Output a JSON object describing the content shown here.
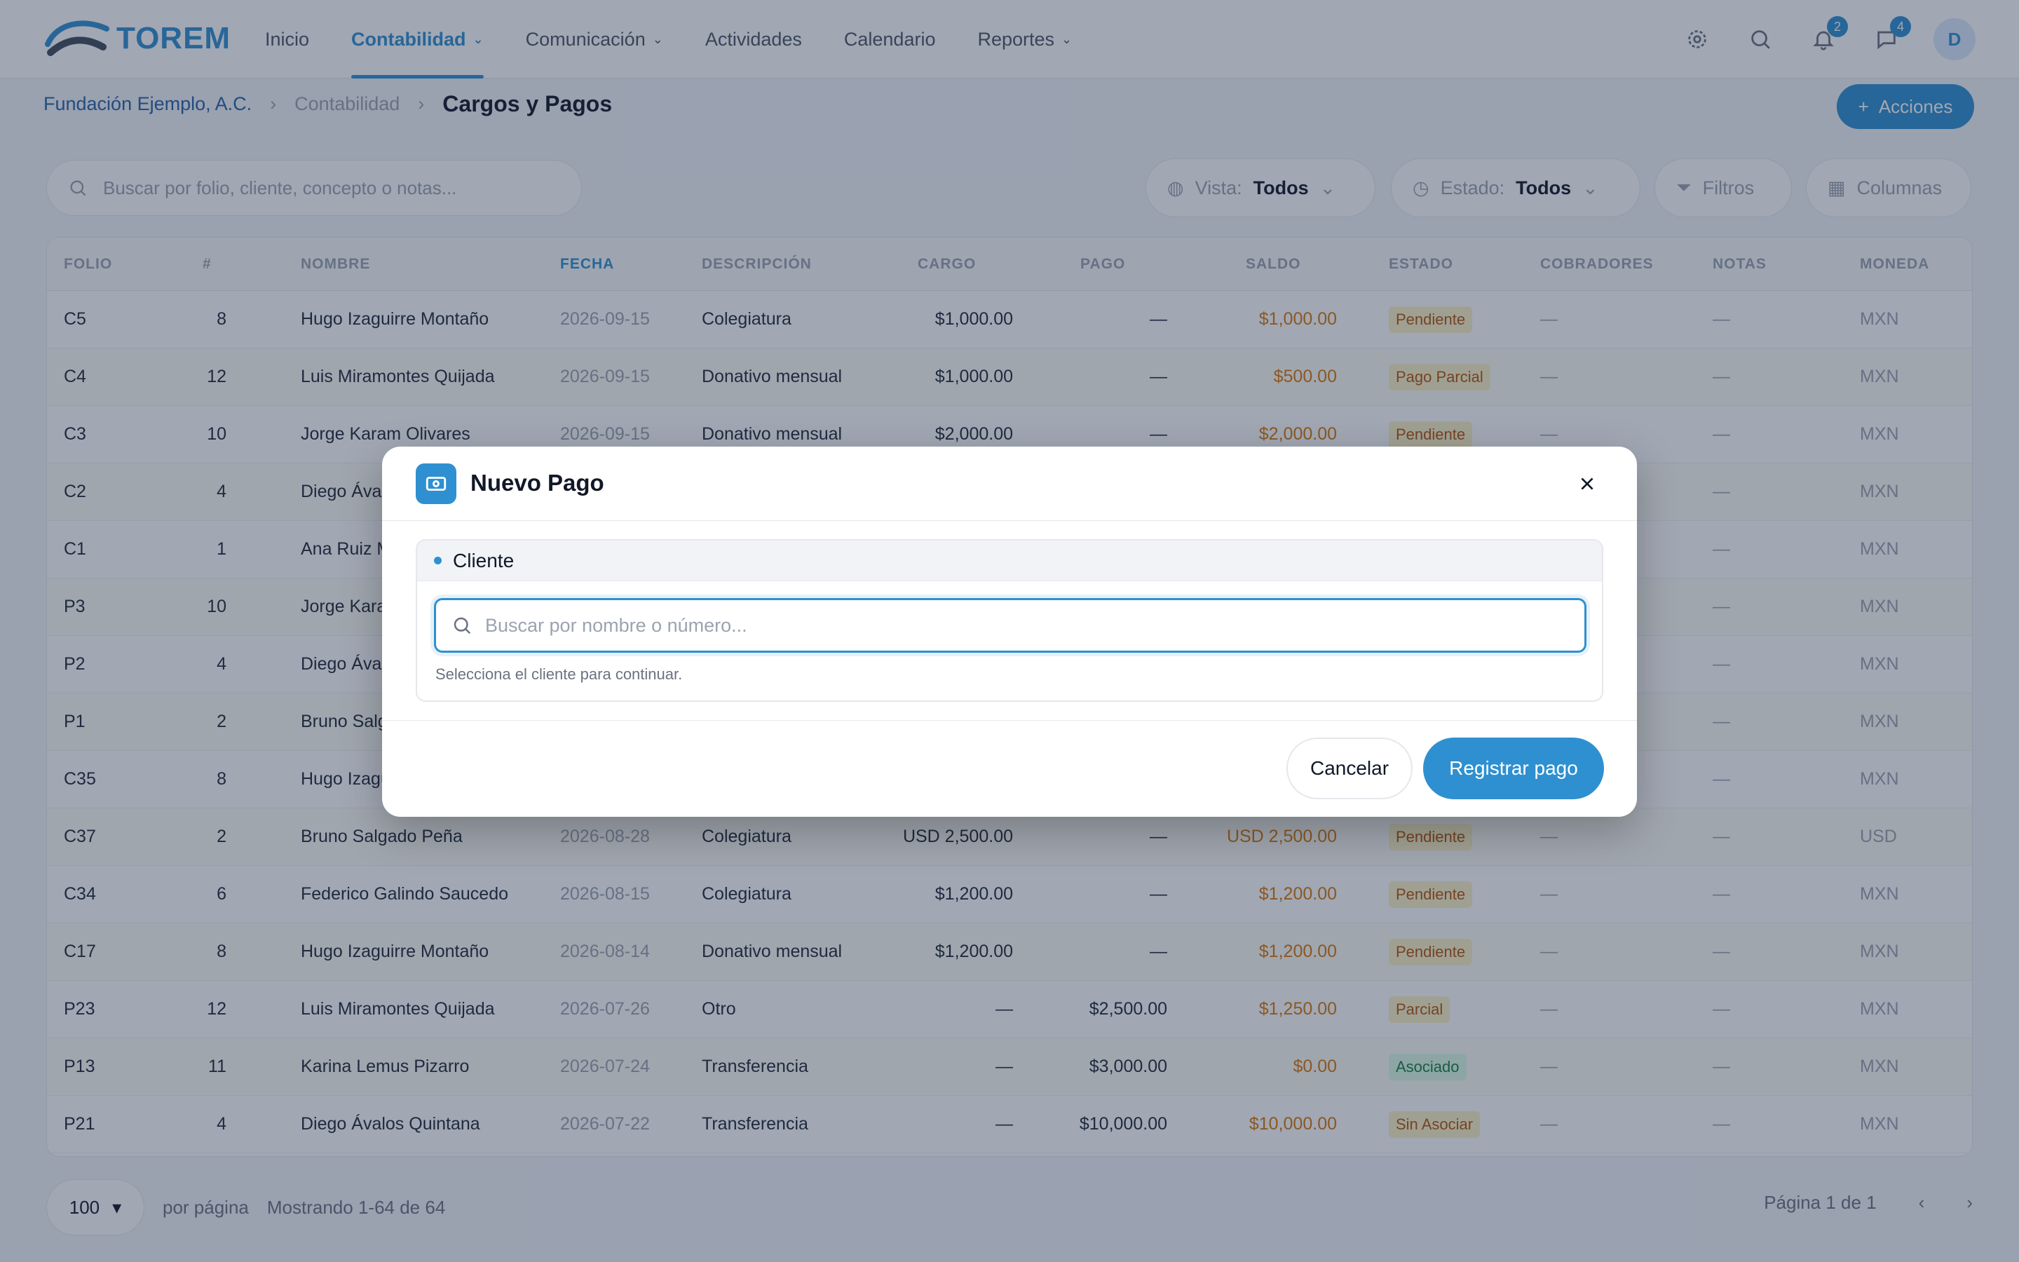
{
  "app": {
    "logo_text": "TOREM"
  },
  "nav": {
    "items": [
      {
        "label": "Inicio"
      },
      {
        "label": "Contabilidad"
      },
      {
        "label": "Comunicación"
      },
      {
        "label": "Actividades"
      },
      {
        "label": "Calendario"
      },
      {
        "label": "Reportes"
      }
    ],
    "notif_badge_1": "2",
    "notif_badge_2": "4",
    "avatar_initial": "D"
  },
  "breadcrumb": {
    "org": "Fundación Ejemplo, A.C.",
    "section": "Contabilidad",
    "current": "Cargos y Pagos"
  },
  "actions_label": "Acciones",
  "search": {
    "placeholder": "Buscar por folio, cliente, concepto o notas..."
  },
  "filters": {
    "vista_label": "Vista:",
    "vista_value": "Todos",
    "estado_label": "Estado:",
    "estado_value": "Todos",
    "filtros_label": "Filtros",
    "columnas_label": "Columnas"
  },
  "table": {
    "headers": [
      "FOLIO",
      "#",
      "NOMBRE",
      "FECHA",
      "DESCRIPCIÓN",
      "CARGO",
      "PAGO",
      "SALDO",
      "ESTADO",
      "COBRADORES",
      "NOTAS",
      "MONEDA"
    ],
    "rows": [
      {
        "folio": "C5",
        "num": "8",
        "nombre": "Hugo Izaguirre Montaño",
        "fecha": "2026-09-15",
        "desc": "Colegiatura",
        "cargo": "$1,000.00",
        "pago": "—",
        "saldo": "$1,000.00",
        "estado": "Pendiente",
        "cobr": "—",
        "notas": "—",
        "moneda": "MXN"
      },
      {
        "folio": "C4",
        "num": "12",
        "nombre": "Luis Miramontes Quijada",
        "fecha": "2026-09-15",
        "desc": "Donativo mensual",
        "cargo": "$1,000.00",
        "pago": "—",
        "saldo": "$500.00",
        "estado": "Pago Parcial",
        "cobr": "—",
        "notas": "—",
        "moneda": "MXN"
      },
      {
        "folio": "C3",
        "num": "10",
        "nombre": "Jorge Karam Olivares",
        "fecha": "2026-09-15",
        "desc": "Donativo mensual",
        "cargo": "$2,000.00",
        "pago": "—",
        "saldo": "$2,000.00",
        "estado": "Pendiente",
        "cobr": "—",
        "notas": "—",
        "moneda": "MXN"
      },
      {
        "folio": "C2",
        "num": "4",
        "nombre": "Diego Ávalos Quintana",
        "fecha": "",
        "desc": "",
        "cargo": "",
        "pago": "",
        "saldo": "",
        "estado": "",
        "cobr": "—",
        "notas": "—",
        "moneda": "MXN"
      },
      {
        "folio": "C1",
        "num": "1",
        "nombre": "Ana Ruiz M.",
        "fecha": "",
        "desc": "",
        "cargo": "",
        "pago": "",
        "saldo": "",
        "estado": "",
        "cobr": "—",
        "notas": "—",
        "moneda": "MXN"
      },
      {
        "folio": "P3",
        "num": "10",
        "nombre": "Jorge Karam Olivares",
        "fecha": "",
        "desc": "",
        "cargo": "",
        "pago": "",
        "saldo": "",
        "estado": "",
        "cobr": "—",
        "notas": "—",
        "moneda": "MXN"
      },
      {
        "folio": "P2",
        "num": "4",
        "nombre": "Diego Ávalos Quintana",
        "fecha": "",
        "desc": "",
        "cargo": "",
        "pago": "",
        "saldo": "",
        "estado": "",
        "cobr": "—",
        "notas": "—",
        "moneda": "MXN"
      },
      {
        "folio": "P1",
        "num": "2",
        "nombre": "Bruno Salgado Peña",
        "fecha": "",
        "desc": "",
        "cargo": "",
        "pago": "",
        "saldo": "",
        "estado": "",
        "cobr": "—",
        "notas": "—",
        "moneda": "MXN"
      },
      {
        "folio": "C35",
        "num": "8",
        "nombre": "Hugo Izaguirre Montaño",
        "fecha": "",
        "desc": "",
        "cargo": "",
        "pago": "",
        "saldo": "",
        "estado": "",
        "cobr": "—",
        "notas": "—",
        "moneda": "MXN"
      },
      {
        "folio": "C37",
        "num": "2",
        "nombre": "Bruno Salgado Peña",
        "fecha": "2026-08-28",
        "desc": "Colegiatura",
        "cargo": "USD 2,500.00",
        "pago": "—",
        "saldo": "USD 2,500.00",
        "estado": "Pendiente",
        "cobr": "—",
        "notas": "—",
        "moneda": "USD"
      },
      {
        "folio": "C34",
        "num": "6",
        "nombre": "Federico Galindo Saucedo",
        "fecha": "2026-08-15",
        "desc": "Colegiatura",
        "cargo": "$1,200.00",
        "pago": "—",
        "saldo": "$1,200.00",
        "estado": "Pendiente",
        "cobr": "—",
        "notas": "—",
        "moneda": "MXN"
      },
      {
        "folio": "C17",
        "num": "8",
        "nombre": "Hugo Izaguirre Montaño",
        "fecha": "2026-08-14",
        "desc": "Donativo mensual",
        "cargo": "$1,200.00",
        "pago": "—",
        "saldo": "$1,200.00",
        "estado": "Pendiente",
        "cobr": "—",
        "notas": "—",
        "moneda": "MXN"
      },
      {
        "folio": "P23",
        "num": "12",
        "nombre": "Luis Miramontes Quijada",
        "fecha": "2026-07-26",
        "desc": "Otro",
        "cargo": "—",
        "pago": "$2,500.00",
        "saldo": "$1,250.00",
        "estado": "Parcial",
        "cobr": "—",
        "notas": "—",
        "moneda": "MXN"
      },
      {
        "folio": "P13",
        "num": "11",
        "nombre": "Karina Lemus Pizarro",
        "fecha": "2026-07-24",
        "desc": "Transferencia",
        "cargo": "—",
        "pago": "$3,000.00",
        "saldo": "$0.00",
        "estado": "Asociado",
        "cobr": "—",
        "notas": "—",
        "moneda": "MXN"
      },
      {
        "folio": "P21",
        "num": "4",
        "nombre": "Diego Ávalos Quintana",
        "fecha": "2026-07-22",
        "desc": "Transferencia",
        "cargo": "—",
        "pago": "$10,000.00",
        "saldo": "$10,000.00",
        "estado": "Sin Asociar",
        "cobr": "—",
        "notas": "—",
        "moneda": "MXN"
      }
    ]
  },
  "pager": {
    "size": "100",
    "per_page": "por página",
    "showing": "Mostrando 1-64 de 64",
    "page_info": "Página 1 de 1"
  },
  "modal": {
    "title": "Nuevo Pago",
    "section_label": "Cliente",
    "input_placeholder": "Buscar por nombre o número...",
    "hint": "Selecciona el cliente para continuar.",
    "cancel_label": "Cancelar",
    "submit_label": "Registrar pago"
  },
  "colors": {
    "accent": "#2e90d0",
    "overlay": "rgba(30,45,75,0.42)"
  }
}
